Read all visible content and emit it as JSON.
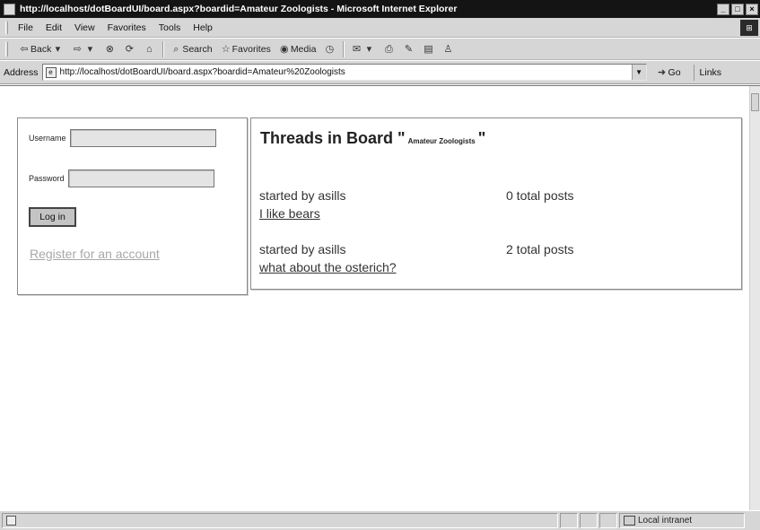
{
  "window": {
    "title": "http://localhost/dotBoardUI/board.aspx?boardid=Amateur Zoologists - Microsoft Internet Explorer"
  },
  "menu": [
    "File",
    "Edit",
    "View",
    "Favorites",
    "Tools",
    "Help"
  ],
  "toolbar": {
    "back_label": "Back",
    "search_label": "Search",
    "favorites_label": "Favorites",
    "media_label": "Media"
  },
  "address": {
    "label": "Address",
    "url": "http://localhost/dotBoardUI/board.aspx?boardid=Amateur%20Zoologists",
    "go_label": "Go",
    "links_label": "Links"
  },
  "login": {
    "username_label": "Username",
    "password_label": "Password",
    "username_value": "",
    "password_value": "",
    "login_button": "Log in",
    "register_link": "Register for an account"
  },
  "board": {
    "heading_prefix": "Threads in Board \"",
    "board_name": "Amateur Zoologists",
    "heading_suffix": "\"",
    "threads": [
      {
        "starter": "started by asills",
        "posts": "0 total posts",
        "title": "I like bears"
      },
      {
        "starter": "started by asills",
        "posts": "2 total posts",
        "title": "what about the osterich?"
      }
    ]
  },
  "status": {
    "zone": "Local intranet"
  }
}
